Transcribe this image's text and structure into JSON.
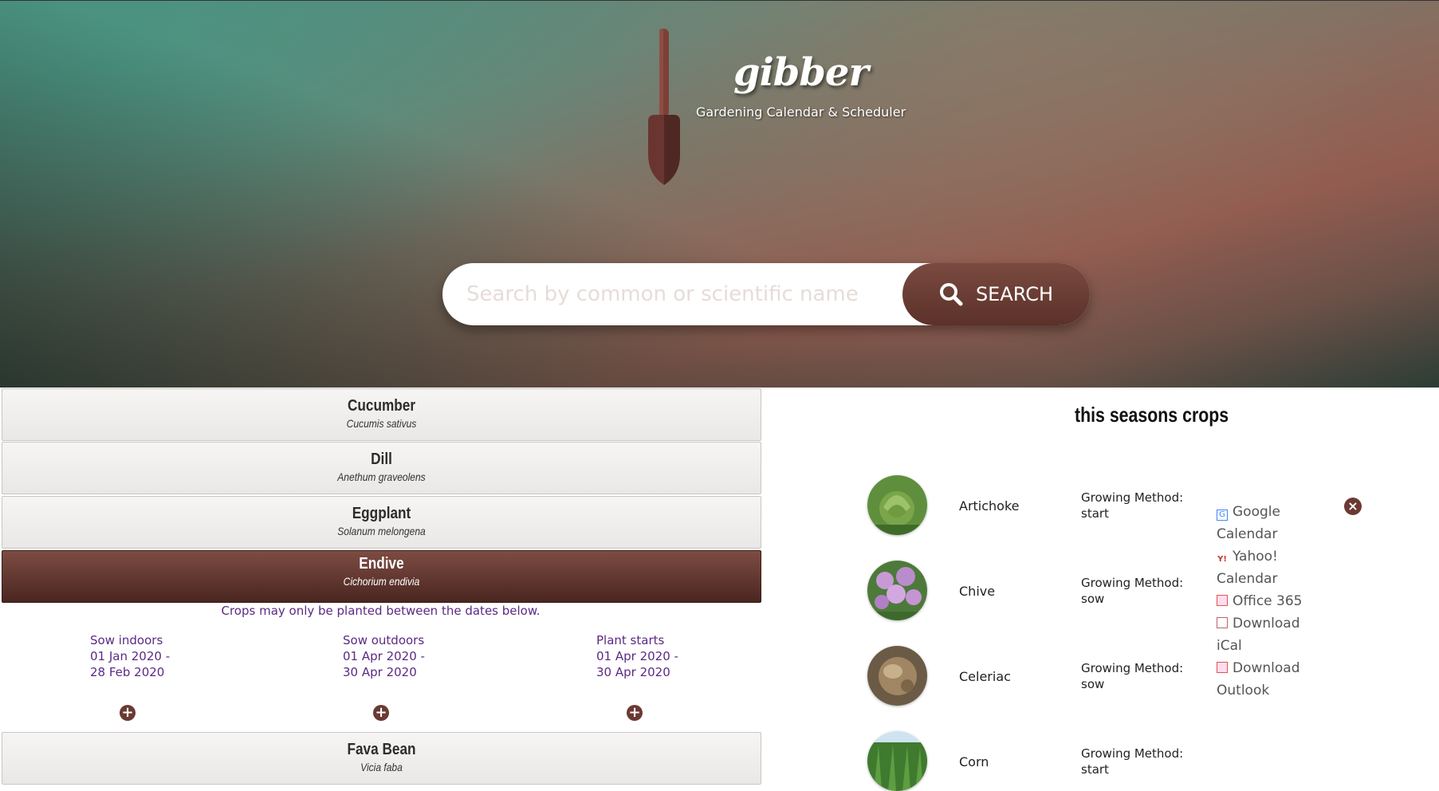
{
  "header": {
    "logo_title": "gibber",
    "logo_subtitle": "Gardening Calendar & Scheduler",
    "logo_icon": "trowel-icon"
  },
  "search": {
    "placeholder": "Search by common or scientific name",
    "button_label": "SEARCH",
    "icon": "search-icon"
  },
  "crop_list": [
    {
      "name": "Cucumber",
      "scientific": "Cucumis sativus"
    },
    {
      "name": "Dill",
      "scientific": "Anethum graveolens"
    },
    {
      "name": "Eggplant",
      "scientific": "Solanum melongena"
    },
    {
      "name": "Endive",
      "scientific": "Cichorium endivia"
    },
    {
      "name": "Fava Bean",
      "scientific": "Vicia faba"
    }
  ],
  "selected_crop": {
    "note": "Crops may only be planted between the dates below.",
    "windows": [
      {
        "label": "Sow indoors",
        "start": "01 Jan 2020 -",
        "end": "28 Feb 2020"
      },
      {
        "label": "Sow outdoors",
        "start": "01 Apr 2020 -",
        "end": "30 Apr 2020"
      },
      {
        "label": "Plant starts",
        "start": "01 Apr 2020 -",
        "end": "30 Apr 2020"
      }
    ]
  },
  "season": {
    "title": "this seasons crops",
    "rows": [
      {
        "name": "Artichoke",
        "method_label": "Growing Method:",
        "method": "start"
      },
      {
        "name": "Chive",
        "method_label": "Growing Method:",
        "method": "sow"
      },
      {
        "name": "Celeriac",
        "method_label": "Growing Method:",
        "method": "sow"
      },
      {
        "name": "Corn",
        "method_label": "Growing Method:",
        "method": "start"
      }
    ],
    "calendar_options": [
      {
        "label": "Google Calendar",
        "icon": "google-icon"
      },
      {
        "label": "Yahoo! Calendar",
        "icon": "yahoo-icon"
      },
      {
        "label": "Office 365",
        "icon": "office-calendar-icon"
      },
      {
        "label": "Download iCal",
        "icon": "ical-icon"
      },
      {
        "label": "Download Outlook",
        "icon": "outlook-icon"
      }
    ],
    "close_icon": "close-circle-icon"
  },
  "colors": {
    "accent": "#6a3a32",
    "active_item": "#5b3129",
    "link_purple": "#5b2a83"
  }
}
